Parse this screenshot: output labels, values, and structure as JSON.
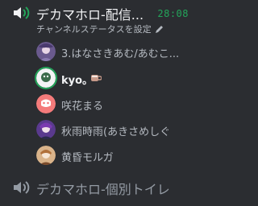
{
  "channels": [
    {
      "name": "デカマホロ-配信...",
      "timer": "28:08",
      "status_text": "チャンネルステータスを設定",
      "users": [
        {
          "name": "3.はなさきあむ/あむこ..."
        },
        {
          "name": "kyo。"
        },
        {
          "name": "咲花まる"
        },
        {
          "name": "秋雨時雨(あきさめしぐ"
        },
        {
          "name": "黄昏モルガ"
        }
      ]
    },
    {
      "name": "デカマホロ-個別トイレ"
    }
  ],
  "icons": {
    "voice": "speaker-icon",
    "edit": "pencil-icon",
    "cup": "coffee-cup-icon"
  },
  "colors": {
    "background": "#2b2d31",
    "timer": "#23a55a",
    "text_active": "#f2f3f5",
    "text_muted": "#949ba4"
  }
}
